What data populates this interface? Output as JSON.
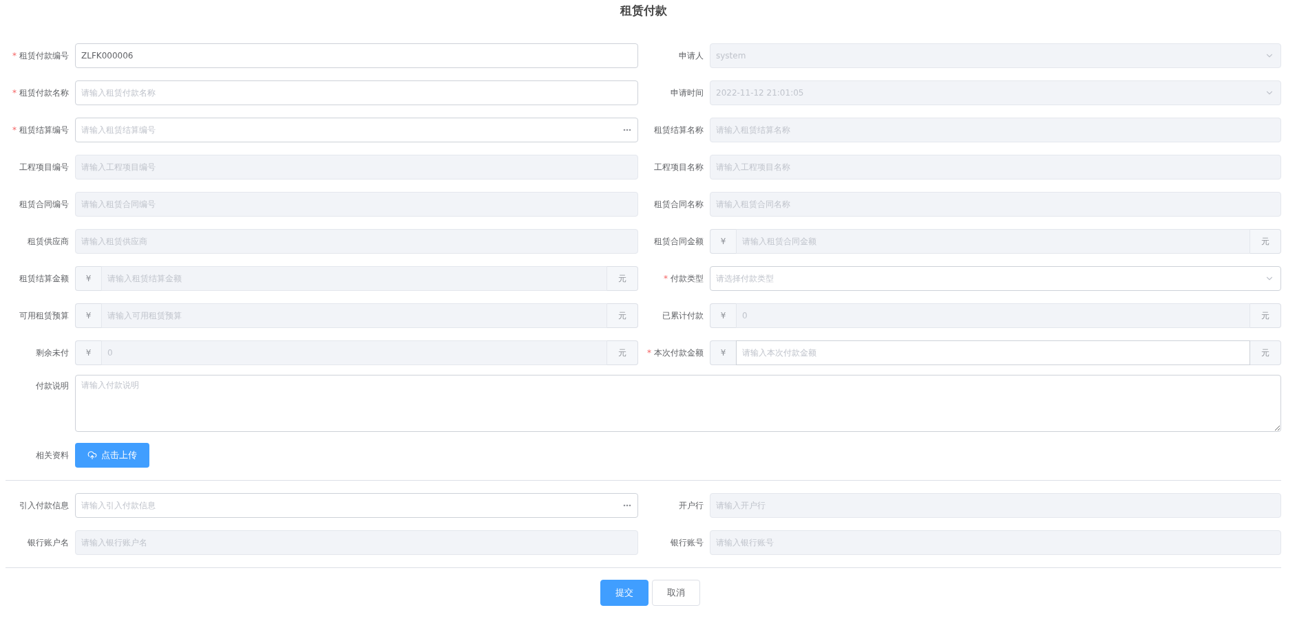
{
  "title": "租赁付款",
  "required_mark": "*",
  "rows": [
    [
      {
        "kind": "text",
        "label": "租赁付款编号",
        "required": true,
        "disabled": false,
        "value": "ZLFK000006"
      },
      {
        "kind": "select",
        "label": "申请人",
        "required": false,
        "disabled": true,
        "value": "system"
      }
    ],
    [
      {
        "kind": "text",
        "label": "租赁付款名称",
        "required": true,
        "disabled": false,
        "placeholder": "请输入租赁付款名称"
      },
      {
        "kind": "select",
        "label": "申请时间",
        "required": false,
        "disabled": true,
        "value": "2022-11-12 21:01:05"
      }
    ],
    [
      {
        "kind": "lookup",
        "label": "租赁结算编号",
        "required": true,
        "disabled": false,
        "placeholder": "请输入租赁结算编号"
      },
      {
        "kind": "text",
        "label": "租赁结算名称",
        "required": false,
        "disabled": true,
        "placeholder": "请输入租赁结算名称"
      }
    ],
    [
      {
        "kind": "text",
        "label": "工程项目编号",
        "required": false,
        "disabled": true,
        "placeholder": "请输入工程项目编号"
      },
      {
        "kind": "text",
        "label": "工程项目名称",
        "required": false,
        "disabled": true,
        "placeholder": "请输入工程项目名称"
      }
    ],
    [
      {
        "kind": "text",
        "label": "租赁合同编号",
        "required": false,
        "disabled": true,
        "placeholder": "请输入租赁合同编号"
      },
      {
        "kind": "text",
        "label": "租赁合同名称",
        "required": false,
        "disabled": true,
        "placeholder": "请输入租赁合同名称"
      }
    ],
    [
      {
        "kind": "text",
        "label": "租赁供应商",
        "required": false,
        "disabled": true,
        "placeholder": "请输入租赁供应商"
      },
      {
        "kind": "money",
        "label": "租赁合同金额",
        "required": false,
        "disabled": true,
        "prefix": "¥",
        "suffix": "元",
        "placeholder": "请输入租赁合同金额"
      }
    ],
    [
      {
        "kind": "money",
        "label": "租赁结算金额",
        "required": false,
        "disabled": true,
        "prefix": "¥",
        "suffix": "元",
        "placeholder": "请输入租赁结算金额"
      },
      {
        "kind": "select",
        "label": "付款类型",
        "required": true,
        "disabled": false,
        "placeholder": "请选择付款类型"
      }
    ],
    [
      {
        "kind": "money",
        "label": "可用租赁预算",
        "required": false,
        "disabled": true,
        "prefix": "¥",
        "suffix": "元",
        "placeholder": "请输入可用租赁预算"
      },
      {
        "kind": "money",
        "label": "已累计付款",
        "required": false,
        "disabled": true,
        "prefix": "¥",
        "suffix": "元",
        "value": "0"
      }
    ],
    [
      {
        "kind": "money",
        "label": "剩余未付",
        "required": false,
        "disabled": true,
        "prefix": "¥",
        "suffix": "元",
        "value": "0"
      },
      {
        "kind": "money",
        "label": "本次付款金额",
        "required": true,
        "disabled": false,
        "prefix": "¥",
        "suffix": "元",
        "placeholder": "请输入本次付款金额"
      }
    ]
  ],
  "description": {
    "label": "付款说明",
    "placeholder": "请输入付款说明"
  },
  "attachments": {
    "label": "相关资料",
    "button": "点击上传"
  },
  "bank_rows": [
    [
      {
        "kind": "lookup",
        "label": "引入付款信息",
        "required": false,
        "disabled": false,
        "placeholder": "请输入引入付款信息"
      },
      {
        "kind": "text",
        "label": "开户行",
        "required": false,
        "disabled": true,
        "placeholder": "请输入开户行"
      }
    ],
    [
      {
        "kind": "text",
        "label": "银行账户名",
        "required": false,
        "disabled": true,
        "placeholder": "请输入银行账户名"
      },
      {
        "kind": "text",
        "label": "银行账号",
        "required": false,
        "disabled": true,
        "placeholder": "请输入银行账号"
      }
    ]
  ],
  "buttons": [
    {
      "label": "提交",
      "primary": true
    },
    {
      "label": "取消",
      "primary": false
    }
  ]
}
